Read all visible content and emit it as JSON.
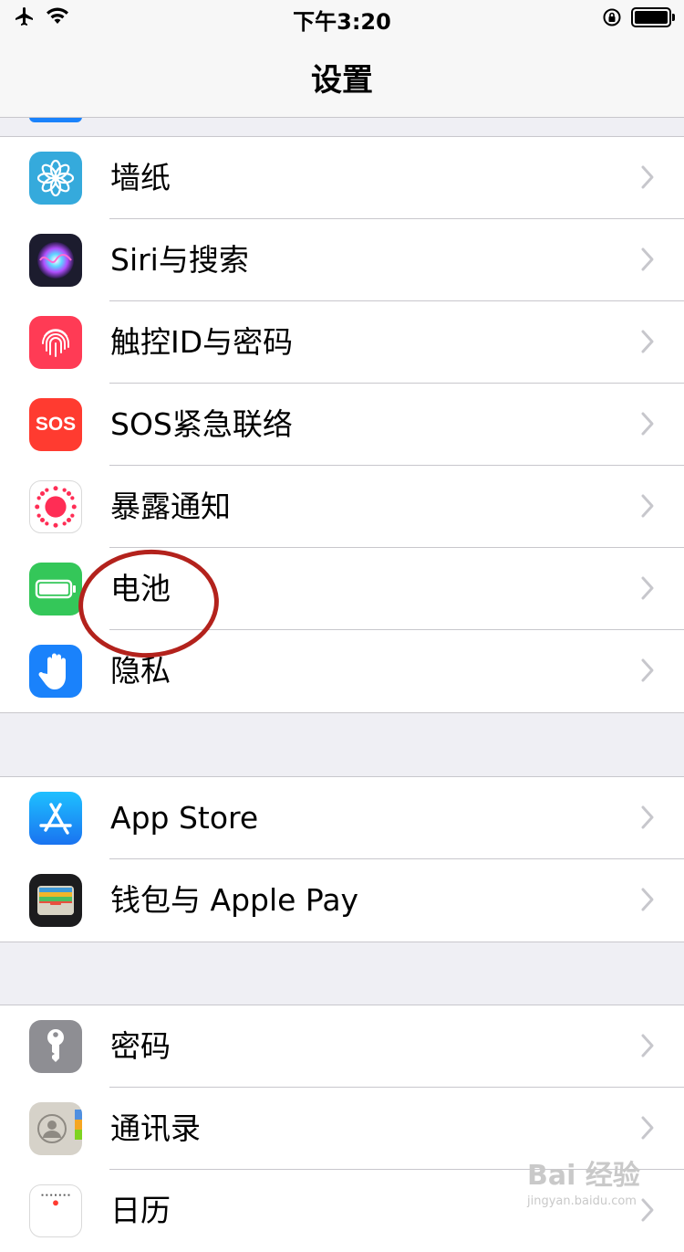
{
  "status_bar": {
    "time": "下午3:20",
    "left_icons": [
      "airplane-icon",
      "wifi-icon"
    ],
    "right_icons": [
      "orientation-lock-icon",
      "battery-icon"
    ]
  },
  "nav": {
    "title": "设置"
  },
  "groups": [
    {
      "rows": [
        {
          "label": "墙纸",
          "icon": "wallpaper-icon",
          "color": "#35aadc"
        },
        {
          "label": "Siri与搜索",
          "icon": "siri-icon",
          "color": "#1c1c2e"
        },
        {
          "label": "触控ID与密码",
          "icon": "touch-id-icon",
          "color": "#ff3b55"
        },
        {
          "label": "SOS紧急联络",
          "icon": "sos-icon",
          "color": "#ff3b30",
          "icon_text": "SOS"
        },
        {
          "label": "暴露通知",
          "icon": "exposure-notification-icon",
          "color": "#ff2d55"
        },
        {
          "label": "电池",
          "icon": "battery-settings-icon",
          "color": "#34c759"
        },
        {
          "label": "隐私",
          "icon": "privacy-hand-icon",
          "color": "#1a82fb"
        }
      ]
    },
    {
      "rows": [
        {
          "label": "App Store",
          "icon": "app-store-icon",
          "color": "#1a8cff"
        },
        {
          "label": "钱包与 Apple Pay",
          "icon": "wallet-icon",
          "color": "#1c1c1e"
        }
      ]
    },
    {
      "rows": [
        {
          "label": "密码",
          "icon": "key-icon",
          "color": "#8e8e93"
        },
        {
          "label": "通讯录",
          "icon": "contacts-icon",
          "color": "#d6d2c9"
        },
        {
          "label": "日历",
          "icon": "calendar-icon",
          "color": "#ffffff"
        }
      ]
    }
  ],
  "annotation": {
    "target": "电池",
    "color": "#b3221c"
  },
  "watermark": {
    "line1": "Bai 经验",
    "line2": "jingyan.baidu.com"
  }
}
